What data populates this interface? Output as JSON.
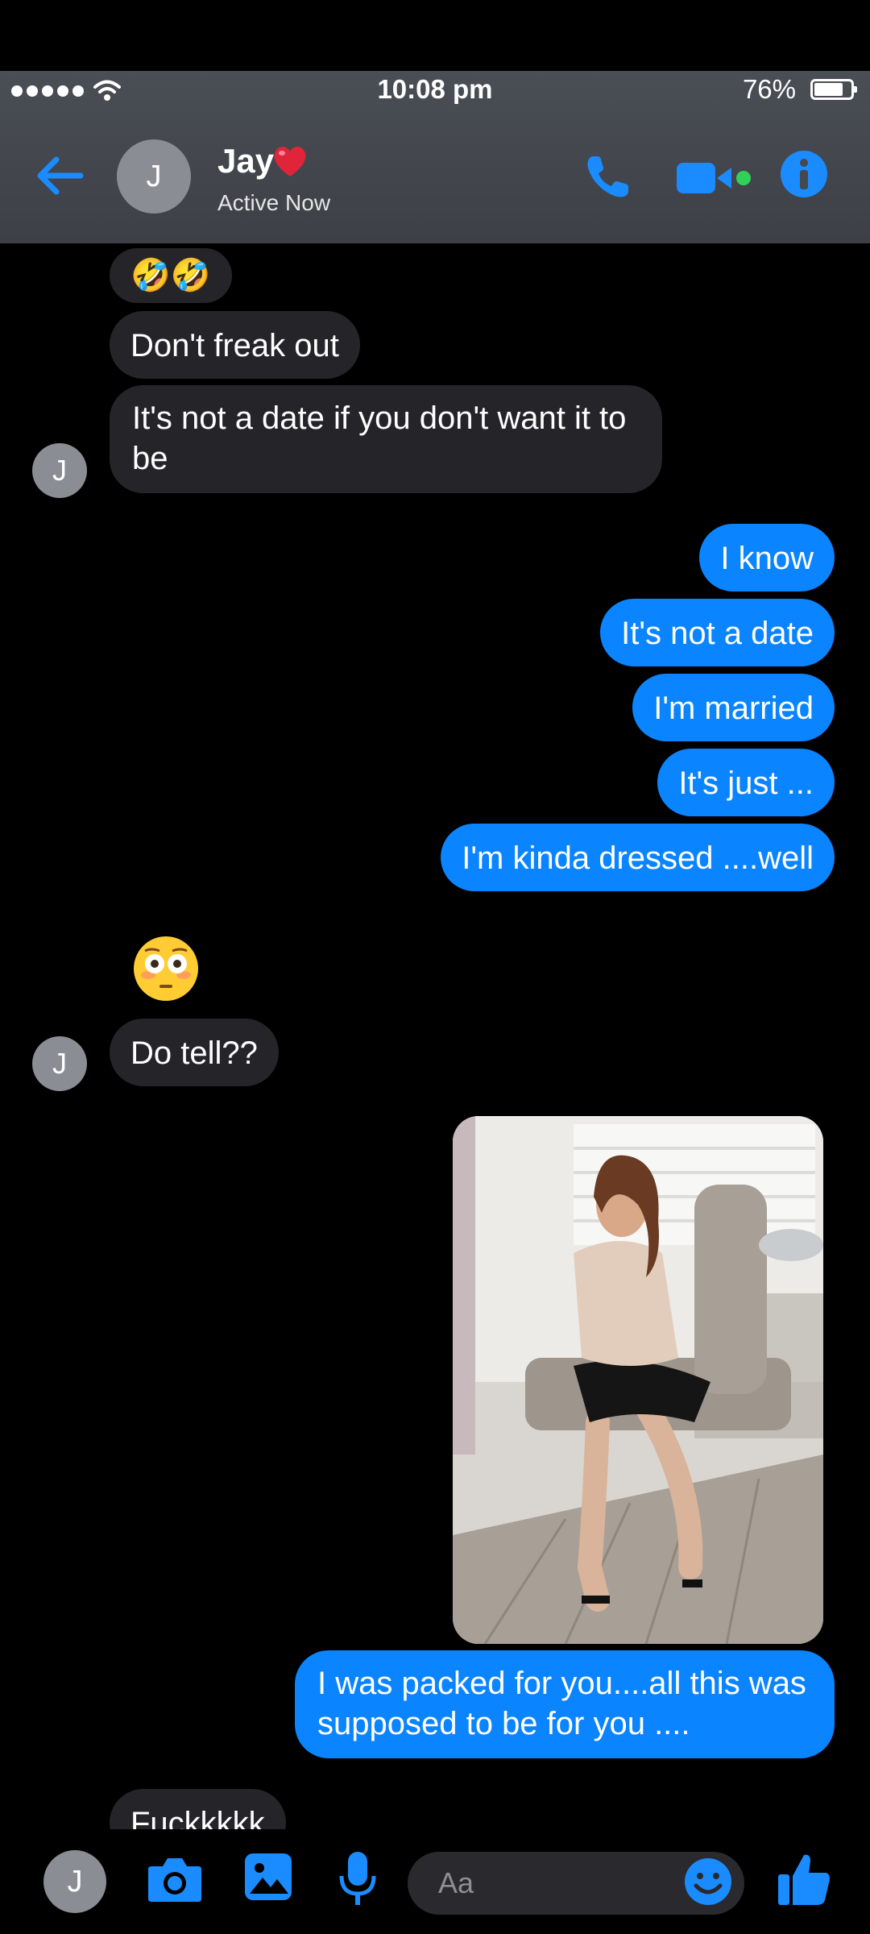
{
  "status_bar": {
    "time": "10:08 pm",
    "battery": "76%"
  },
  "header": {
    "contact_name": "Jay",
    "status": "Active Now",
    "avatar_initial": "J"
  },
  "messages": [
    {
      "from": "them",
      "type": "emoji",
      "text": "🤣🤣"
    },
    {
      "from": "them",
      "type": "text",
      "text": "Don't freak out"
    },
    {
      "from": "them",
      "type": "text",
      "text": "It's not a date if you don't want it to be"
    },
    {
      "from": "me",
      "type": "text",
      "text": "I know"
    },
    {
      "from": "me",
      "type": "text",
      "text": "It's not a date"
    },
    {
      "from": "me",
      "type": "text",
      "text": "I'm married"
    },
    {
      "from": "me",
      "type": "text",
      "text": "It's just ..."
    },
    {
      "from": "me",
      "type": "text",
      "text": "I'm kinda dressed ....well"
    },
    {
      "from": "them",
      "type": "big-emoji",
      "icon": "flushed-face-emoji"
    },
    {
      "from": "them",
      "type": "text",
      "text": "Do tell??"
    },
    {
      "from": "me",
      "type": "photo",
      "icon": "photo-woman-seated"
    },
    {
      "from": "me",
      "type": "text",
      "text": "I was packed for you....all this was supposed to be for you ...."
    },
    {
      "from": "them",
      "type": "text",
      "text": "Fuckkkkk"
    }
  ],
  "composer": {
    "avatar_initial": "J",
    "placeholder": "Aa"
  },
  "colors": {
    "accent": "#0a84ff",
    "incoming_bubble": "#252529",
    "header_bg": "#45484e",
    "online_dot": "#30d158",
    "heart": "#e0243a"
  },
  "icons": [
    "back-arrow-icon",
    "heart-icon",
    "phone-icon",
    "video-icon",
    "info-icon",
    "camera-icon",
    "gallery-icon",
    "microphone-icon",
    "emoji-icon",
    "thumbs-up-icon",
    "wifi-icon"
  ]
}
